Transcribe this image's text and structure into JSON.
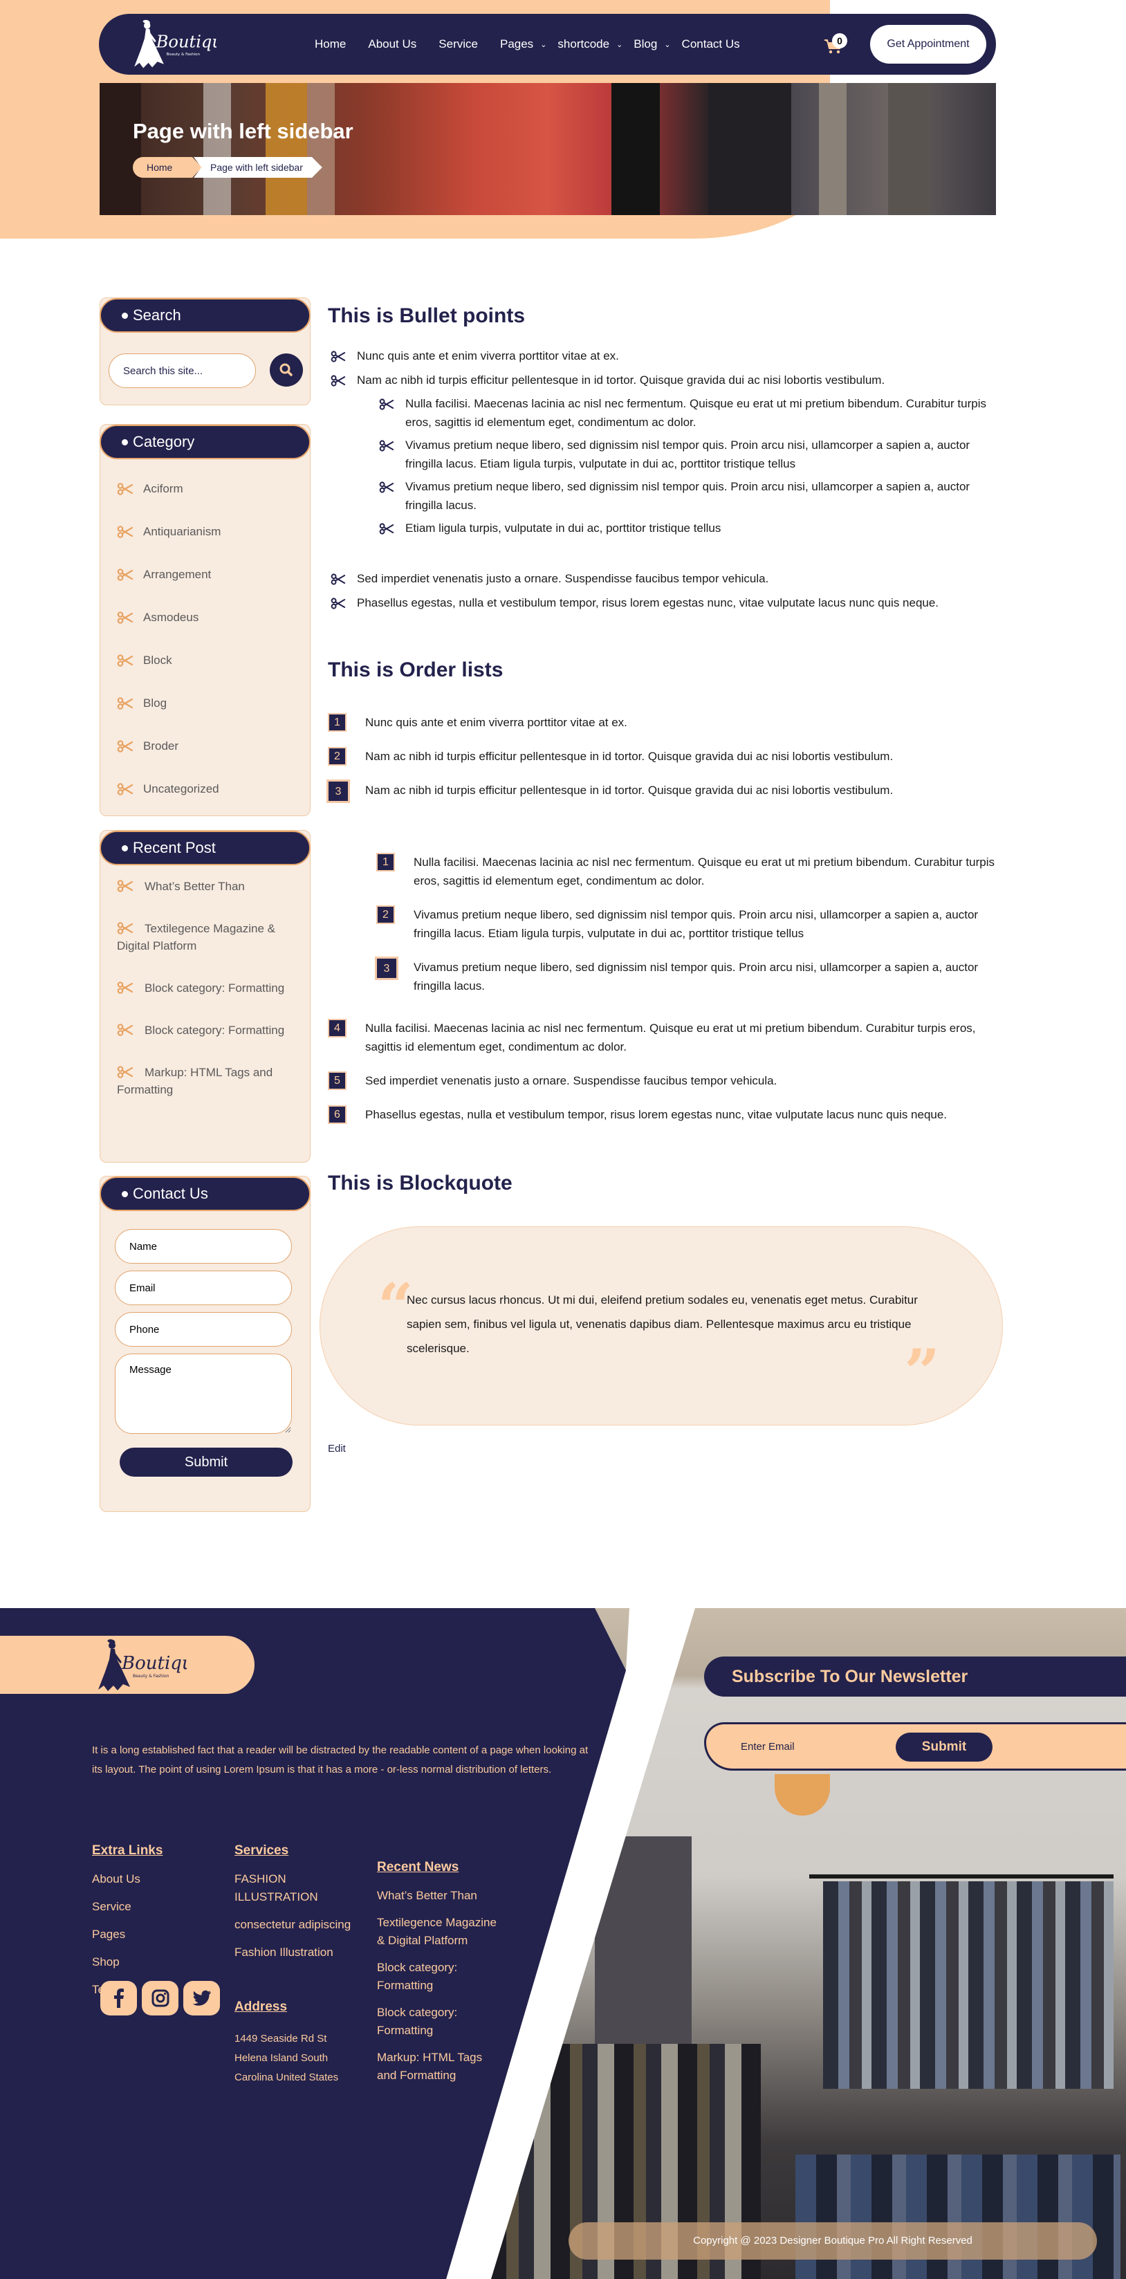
{
  "colors": {
    "navy": "#23224c",
    "peach": "#fccb9f",
    "cream": "#f8ebe0",
    "accent_border": "#e7a468",
    "white": "#ffffff"
  },
  "header": {
    "logo": {
      "brand": "Boutique",
      "tagline": "Beauty & Fashion",
      "icon": "dress-silhouette-logo"
    },
    "nav": [
      {
        "label": "Home",
        "has_dropdown": false
      },
      {
        "label": "About Us",
        "has_dropdown": false
      },
      {
        "label": "Service",
        "has_dropdown": false
      },
      {
        "label": "Pages",
        "has_dropdown": true
      },
      {
        "label": "shortcode",
        "has_dropdown": true
      },
      {
        "label": "Blog",
        "has_dropdown": true
      },
      {
        "label": "Contact Us",
        "has_dropdown": false
      }
    ],
    "cart": {
      "icon": "cart-icon",
      "count": "0"
    },
    "cta_label": "Get Appointment"
  },
  "banner": {
    "title": "Page with left sidebar",
    "breadcrumb": [
      "Home",
      "Page with left sidebar"
    ]
  },
  "sidebar": {
    "search": {
      "title": "Search",
      "placeholder": "Search this site...",
      "button_icon": "search-icon"
    },
    "category": {
      "title": "Category",
      "items": [
        "Aciform",
        "Antiquarianism",
        "Arrangement",
        "Asmodeus",
        "Block",
        "Blog",
        "Broder",
        "Uncategorized"
      ]
    },
    "recent_post": {
      "title": "Recent Post",
      "items": [
        "What’s Better Than",
        "Textilegence Magazine & Digital Platform",
        "Block category: Formatting",
        "Block category: Formatting",
        "Markup: HTML Tags and Formatting"
      ]
    },
    "contact": {
      "title": "Contact Us",
      "name_placeholder": "Name",
      "email_placeholder": "Email",
      "phone_placeholder": "Phone",
      "message_placeholder": "Message",
      "submit_label": "Submit"
    }
  },
  "content": {
    "bullets": {
      "heading": "This is Bullet points",
      "items": [
        "Nunc quis ante et enim viverra porttitor vitae at ex.",
        "Nam ac nibh id turpis efficitur pellentesque in id tortor. Quisque gravida dui ac nisi lobortis vestibulum."
      ],
      "sub_items": [
        "Nulla facilisi. Maecenas lacinia ac nisl nec fermentum. Quisque eu erat ut mi pretium bibendum. Curabitur turpis eros, sagittis id elementum eget, condimentum ac dolor.",
        "Vivamus pretium neque libero, sed dignissim nisl tempor quis. Proin arcu nisi, ullamcorper a sapien a, auctor fringilla lacus. Etiam ligula turpis, vulputate in dui ac, porttitor tristique tellus",
        "Vivamus pretium neque libero, sed dignissim nisl tempor quis. Proin arcu nisi, ullamcorper a sapien a, auctor fringilla lacus.",
        "Etiam ligula turpis, vulputate in dui ac, porttitor tristique tellus"
      ],
      "items_after": [
        "Sed imperdiet venenatis justo a ornare. Suspendisse faucibus tempor vehicula.",
        "Phasellus egestas, nulla et vestibulum tempor, risus lorem egestas nunc, vitae vulputate lacus nunc quis neque."
      ]
    },
    "ordered": {
      "heading": "This is Order lists",
      "items": [
        {
          "num": "1",
          "text": "Nunc quis ante et enim viverra porttitor vitae at ex."
        },
        {
          "num": "2",
          "text": "Nam ac nibh id turpis efficitur pellentesque in id tortor. Quisque gravida dui ac nisi lobortis vestibulum."
        },
        {
          "num": "3",
          "text": "Nam ac nibh id turpis efficitur pellentesque in id tortor. Quisque gravida dui ac nisi lobortis vestibulum."
        }
      ],
      "sub_items": [
        {
          "num": "1",
          "text": "Nulla facilisi. Maecenas lacinia ac nisl nec fermentum. Quisque eu erat ut mi pretium bibendum. Curabitur turpis eros, sagittis id elementum eget, condimentum ac dolor."
        },
        {
          "num": "2",
          "text": "Vivamus pretium neque libero, sed dignissim nisl tempor quis. Proin arcu nisi, ullamcorper a sapien a, auctor fringilla lacus. Etiam ligula turpis, vulputate in dui ac, porttitor tristique tellus"
        },
        {
          "num": "3",
          "text": "Vivamus pretium neque libero, sed dignissim nisl tempor quis. Proin arcu nisi, ullamcorper a sapien a, auctor fringilla lacus."
        }
      ],
      "items_after": [
        {
          "num": "4",
          "text": "Nulla facilisi. Maecenas lacinia ac nisl nec fermentum. Quisque eu erat ut mi pretium bibendum. Curabitur turpis eros, sagittis id elementum eget, condimentum ac dolor."
        },
        {
          "num": "5",
          "text": "Sed imperdiet venenatis justo a ornare. Suspendisse faucibus tempor vehicula."
        },
        {
          "num": "6",
          "text": "Phasellus egestas, nulla et vestibulum tempor, risus lorem egestas nunc, vitae vulputate lacus nunc quis neque."
        }
      ]
    },
    "blockquote": {
      "heading": "This is Blockquote",
      "text": "Nec cursus lacus rhoncus. Ut mi dui, eleifend pretium sodales eu, venenatis eget metus. Curabitur sapien sem, finibus vel ligula ut, venenatis dapibus diam. Pellentesque maximus arcu eu tristique scelerisque.",
      "open_mark": "“",
      "close_mark": "”"
    },
    "edit_label": "Edit"
  },
  "footer": {
    "logo": {
      "brand": "Boutique",
      "tagline": "Beauty & Fashion"
    },
    "about": "It is a long established fact that a reader will be distracted by the readable content of a page when looking at its layout. The point of using Lorem Ipsum is that it has a more - or-less normal distribution of letters.",
    "extra_links": {
      "title": "Extra Links",
      "items": [
        "About Us",
        "Service",
        "Pages",
        "Shop",
        "Team"
      ]
    },
    "services": {
      "title": "Services",
      "items": [
        "FASHION ILLUSTRATION",
        "consectetur adipiscing",
        "Fashion Illustration"
      ]
    },
    "address": {
      "title": "Address",
      "lines": [
        "1449 Seaside Rd St",
        "Helena Island South",
        "Carolina United States"
      ]
    },
    "recent_news": {
      "title": "Recent News",
      "items": [
        "What’s Better Than",
        "Textilegence Magazine & Digital Platform",
        "Block category: Formatting",
        "Block category: Formatting",
        "Markup: HTML Tags and Formatting"
      ]
    },
    "socials": [
      "facebook-icon",
      "instagram-icon",
      "twitter-icon"
    ],
    "newsletter": {
      "title": "Subscribe To Our Newsletter",
      "placeholder": "Enter Email",
      "submit_label": "Submit"
    },
    "copyright": "Copyright @ 2023 Designer Boutique Pro All Right Reserved"
  }
}
